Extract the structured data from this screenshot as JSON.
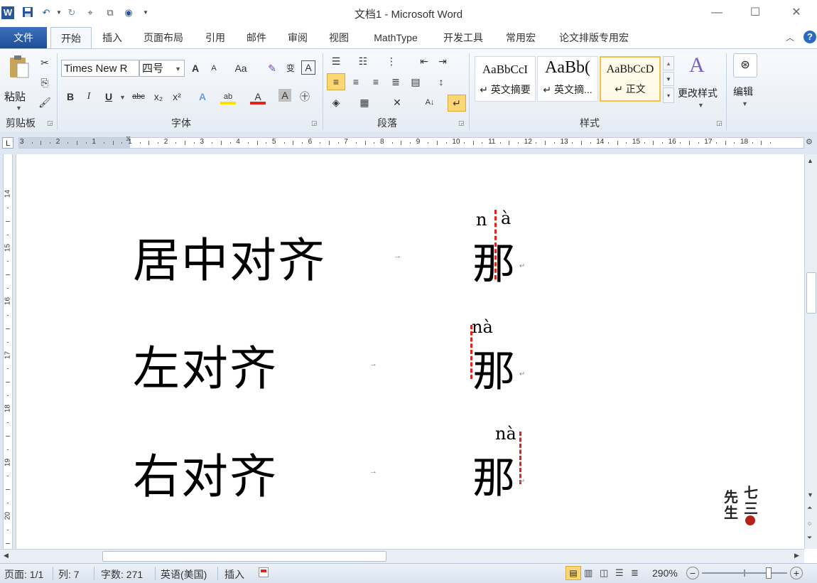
{
  "window": {
    "title": "文档1 - Microsoft Word",
    "app_icon": "W",
    "controls": {
      "minimize": "—",
      "maximize": "☐",
      "close": "✕"
    }
  },
  "tabs": [
    "文件",
    "开始",
    "插入",
    "页面布局",
    "引用",
    "邮件",
    "审阅",
    "视图",
    "MathType",
    "开发工具",
    "常用宏",
    "论文排版专用宏"
  ],
  "active_tab": "开始",
  "ribbon": {
    "clipboard": {
      "paste_label": "粘贴",
      "group_label": "剪贴板"
    },
    "font": {
      "font_name": "Times New R",
      "font_size": "四号",
      "group_label": "字体",
      "buttons": {
        "grow": "A",
        "shrink": "A",
        "case": "Aa",
        "bold": "B",
        "italic": "I",
        "underline": "U",
        "strike": "abc",
        "subscript": "x₂",
        "superscript": "x²",
        "font_color": "A",
        "char_shade": "A",
        "enclose": "㊉"
      }
    },
    "paragraph": {
      "group_label": "段落"
    },
    "styles": {
      "group_label": "样式",
      "items": [
        {
          "sample": "AaBbCcI",
          "name": "↵ 英文摘要"
        },
        {
          "sample": "AaBb(",
          "name": "↵ 英文摘..."
        },
        {
          "sample": "AaBbCcD",
          "name": "↵ 正文",
          "selected": true
        }
      ],
      "change_styles": "更改样式"
    },
    "editing": {
      "label": "编辑"
    }
  },
  "ruler": {
    "h_numbers": [
      "3",
      "2",
      "1",
      "1",
      "2",
      "3",
      "4",
      "5",
      "6",
      "7",
      "8",
      "9",
      "10",
      "11",
      "12",
      "13",
      "14",
      "15",
      "16",
      "17",
      "18"
    ],
    "v_numbers": [
      "14",
      "15",
      "16",
      "17",
      "18",
      "19",
      "20"
    ],
    "corner": "L"
  },
  "document": {
    "rows": [
      {
        "label": "居中对齐",
        "pinyin_parts": [
          "n",
          "à"
        ],
        "char": "那"
      },
      {
        "label": "左对齐",
        "pinyin": "nà",
        "char": "那"
      },
      {
        "label": "右对齐",
        "pinyin": "nà",
        "char": "那"
      }
    ],
    "tab_mark": "→",
    "para_mark": "↵",
    "watermark": [
      "七",
      "三",
      "先",
      "生"
    ]
  },
  "status_bar": {
    "page": "页面: 1/1",
    "column": "列: 7",
    "word_count": "字数: 271",
    "language": "英语(美国)",
    "mode": "插入",
    "zoom": "290%",
    "zoom_level_fraction": 0.78
  },
  "colors": {
    "file_tab": "#2b579a",
    "guide": "#e0231b",
    "accent": "#2a5699"
  }
}
